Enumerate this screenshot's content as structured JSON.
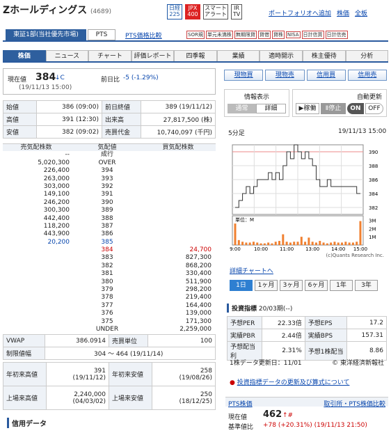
{
  "company": {
    "name": "Zホールディングス",
    "code": "(4689)"
  },
  "top_icons": [
    "日経\n225",
    "JPX\n400",
    "スマート\nアラート",
    "IR\nTV"
  ],
  "top_links": {
    "portfolio": "ポートフォリオへ追加",
    "stock": "株価",
    "all": "全板"
  },
  "market": {
    "selected": "東証1部(当社優先市場)",
    "pts": "PTS",
    "pts_compare": "PTS価格比較"
  },
  "badges": [
    "SOR規",
    "単元未満株",
    "無期限貸",
    "貸借",
    "貸株",
    "NISA",
    "日計信買",
    "日計信売"
  ],
  "nav": [
    "株価",
    "ニュース",
    "チャート",
    "評価レポート",
    "四季報",
    "業績",
    "適時開示",
    "株主優待",
    "分析"
  ],
  "price": {
    "label": "現在値",
    "value": "384",
    "arrow": "↓C",
    "time": "(19/11/13 15:00)",
    "prev_label": "前日比",
    "prev_value": "-5 (-1.29%)"
  },
  "ohlc": [
    [
      "始値",
      "386 (09:00)",
      "前日終値",
      "389 (19/11/12)"
    ],
    [
      "高値",
      "391 (12:30)",
      "出来高",
      "27,817,500 (株)"
    ],
    [
      "安値",
      "382 (09:02)",
      "売買代金",
      "10,740,097 (千円)"
    ]
  ],
  "board": {
    "headers": [
      "売気配株数",
      "気配値",
      "買気配株数"
    ],
    "rows": [
      [
        "--",
        "成行",
        ""
      ],
      [
        "5,020,300",
        "OVER",
        ""
      ],
      [
        "226,400",
        "394",
        ""
      ],
      [
        "263,000",
        "393",
        ""
      ],
      [
        "303,000",
        "392",
        ""
      ],
      [
        "149,100",
        "391",
        ""
      ],
      [
        "246,200",
        "390",
        ""
      ],
      [
        "300,300",
        "389",
        ""
      ],
      [
        "442,400",
        "388",
        ""
      ],
      [
        "118,200",
        "387",
        ""
      ],
      [
        "443,900",
        "386",
        ""
      ],
      [
        "20,200",
        "385",
        ""
      ],
      [
        "",
        "384",
        "24,700"
      ],
      [
        "",
        "383",
        "827,300"
      ],
      [
        "",
        "382",
        "868,200"
      ],
      [
        "",
        "381",
        "330,400"
      ],
      [
        "",
        "380",
        "511,900"
      ],
      [
        "",
        "379",
        "298,200"
      ],
      [
        "",
        "378",
        "219,400"
      ],
      [
        "",
        "377",
        "164,400"
      ],
      [
        "",
        "376",
        "139,000"
      ],
      [
        "",
        "375",
        "171,300"
      ],
      [
        "",
        "UNDER",
        "2,259,000"
      ]
    ]
  },
  "vwap": [
    [
      "VWAP",
      "386.0914",
      "売買単位",
      "100"
    ]
  ],
  "limit": {
    "label": "制限値幅",
    "value": "304 ～ 464 (19/11/14)"
  },
  "ytd": [
    [
      "年初来高値",
      "391",
      "(19/11/12)",
      "年初来安値",
      "258",
      "(19/08/26)"
    ],
    [
      "上場来高値",
      "2,240,000",
      "(04/03/02)",
      "上場来安値",
      "250",
      "(18/12/25)"
    ]
  ],
  "credit_title": "信用データ",
  "trade_buttons": [
    "現物買",
    "現物売",
    "信用買",
    "信用売"
  ],
  "info_display": {
    "label": "情報表示",
    "opts": [
      "通常",
      "詳細"
    ]
  },
  "auto_update": {
    "label": "自動更新",
    "play": "稼働",
    "stop": "停止",
    "on": "ON",
    "off": "OFF"
  },
  "chart_meta": {
    "period": "5分足",
    "time": "19/11/13 15:00",
    "vol_label": "単位：M",
    "credit": "(c)Quants Research Inc.",
    "detail": "詳細チャートへ"
  },
  "chart_data": {
    "type": "line",
    "x": [
      "9:00",
      "10:00",
      "11:00",
      "13:00",
      "14:00",
      "15:00"
    ],
    "price_yticks": [
      382,
      384,
      386,
      388,
      390
    ],
    "price": [
      382,
      383,
      384,
      385,
      384,
      385,
      386,
      386,
      386,
      387,
      386,
      387,
      386,
      388,
      390,
      389,
      391,
      390,
      389,
      390,
      389,
      388,
      386,
      385,
      385,
      386,
      385,
      385,
      385,
      385,
      385,
      385,
      385,
      384,
      384
    ],
    "vol_yticks": [
      "1M",
      "2M",
      "3M"
    ],
    "volume": [
      2.6,
      0.6,
      0.4,
      0.3,
      0.3,
      0.4,
      0.3,
      0.2,
      0.2,
      0.3,
      0.2,
      0.4,
      0.5,
      1.3,
      0.4,
      0.3,
      0.4,
      0.4,
      1.0,
      0.4,
      0.9,
      0.4,
      0.3,
      0.5,
      0.3,
      0.2,
      0.3,
      0.4,
      0.3,
      0.3,
      0.4,
      0.3,
      0.3,
      0.4,
      2.9
    ]
  },
  "ranges": [
    "1日",
    "1ヶ月",
    "3ヶ月",
    "6ヶ月",
    "1年",
    "3年"
  ],
  "indicators": {
    "title": "投資指標",
    "period": "20/03期(--)",
    "rows": [
      [
        "予想PER",
        "22.33倍",
        "予想EPS",
        "17.2"
      ],
      [
        "実績PBR",
        "2.44倍",
        "実績BPS",
        "157.31"
      ],
      [
        "予想配当利",
        "2.31%",
        "予想1株配当",
        "8.86"
      ]
    ],
    "updated": "1株データ更新日：11/01",
    "source": "東洋経済新報社",
    "notice": "投資指標データの更新及び算式について"
  },
  "pts_info": {
    "title": "PTS株価",
    "link": "取引所・PTS株価比較",
    "now_label": "現在値",
    "now": "462",
    "now_mark": "↑#",
    "base_label": "基準値比",
    "base": "+78 (+20.31%) (19/11/13 21:50)"
  }
}
